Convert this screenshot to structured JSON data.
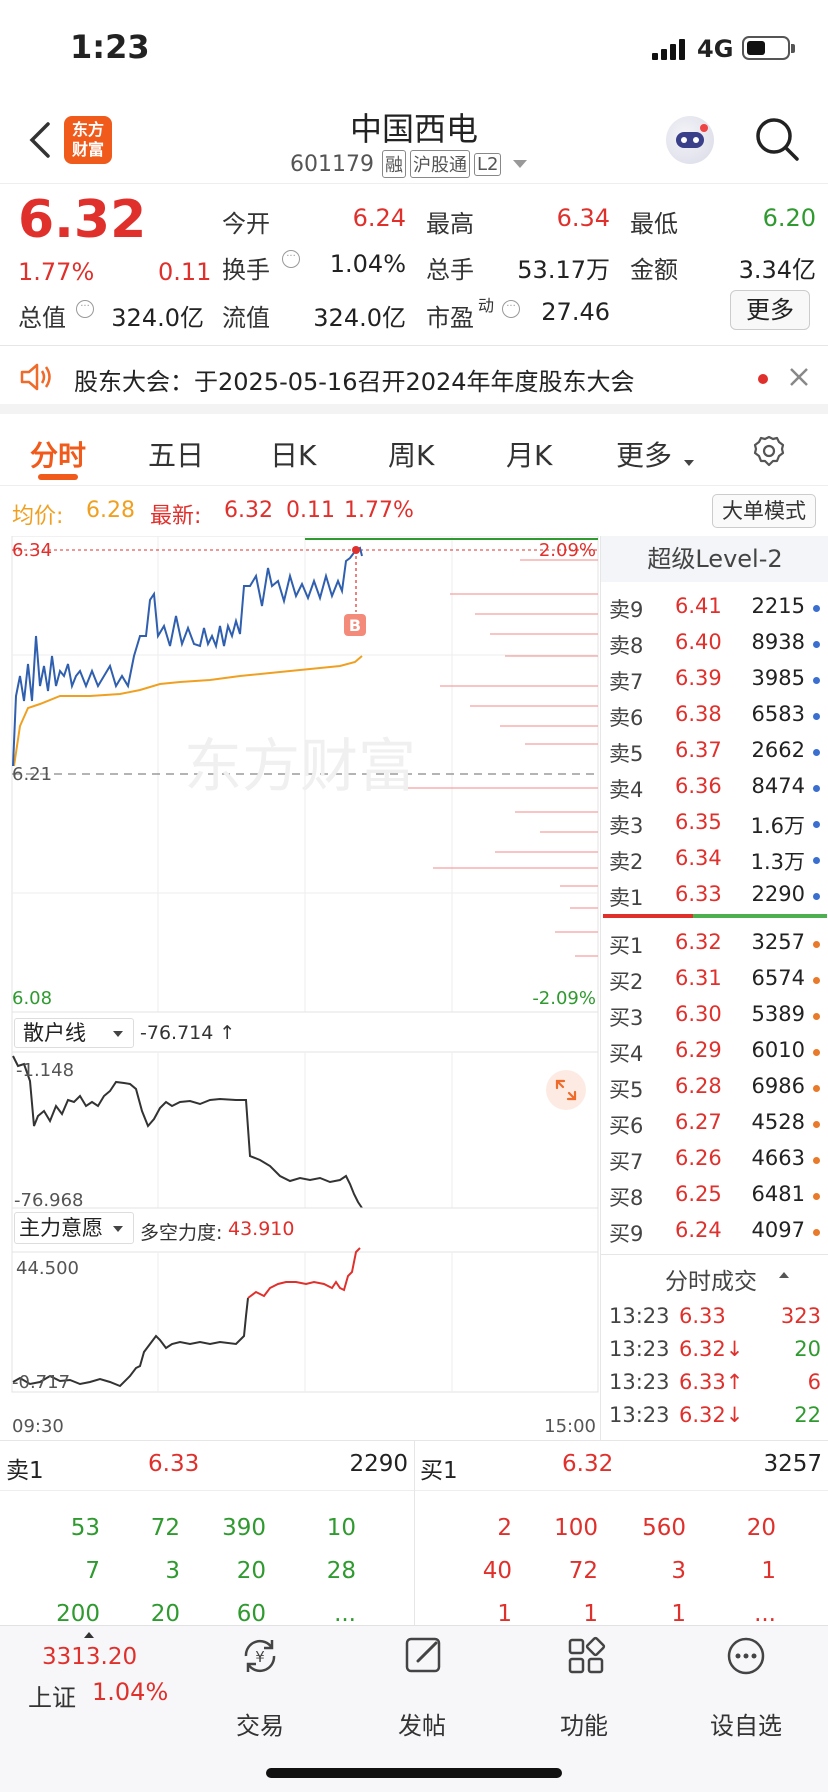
{
  "status_bar": {
    "time": "1:23",
    "network": "4G"
  },
  "header": {
    "logo_text_line1": "东方",
    "logo_text_line2": "财富",
    "stock_name": "中国西电",
    "stock_code": "601179",
    "badges": [
      "融",
      "沪股通",
      "L2"
    ]
  },
  "quote": {
    "price": "6.32",
    "change_pct": "1.77%",
    "change": "0.11",
    "total_value_label": "总值",
    "total_value": "324.0亿",
    "open_label": "今开",
    "open": "6.24",
    "high_label": "最高",
    "high": "6.34",
    "low_label": "最低",
    "low": "6.20",
    "turnover_label": "换手",
    "turnover": "1.04%",
    "volume_label": "总手",
    "volume": "53.17万",
    "amount_label": "金额",
    "amount": "3.34亿",
    "float_value_label": "流值",
    "float_value": "324.0亿",
    "pe_label": "市盈",
    "pe_sup": "动",
    "pe": "27.46",
    "more_button": "更多"
  },
  "notice": {
    "text": "股东大会：于2025-05-16召开2024年年度股东大会"
  },
  "tabs": [
    "分时",
    "五日",
    "日K",
    "周K",
    "月K",
    "更多"
  ],
  "info_line": {
    "avg_label": "均价:",
    "avg": "6.28",
    "latest_label": "最新:",
    "latest": "6.32",
    "chg": "0.11",
    "pct": "1.77%",
    "mode_button": "大单模式"
  },
  "chart": {
    "y_top": "6.34",
    "y_mid": "6.21",
    "y_bottom": "6.08",
    "pct_top": "2.09%",
    "pct_bottom": "-2.09%",
    "watermark": "东方财富",
    "marker": "B",
    "retail_select": "散户线",
    "retail_value": "-76.714 ↑",
    "retail_top": "-1.148",
    "retail_bottom": "-76.968",
    "main_select": "主力意愿",
    "main_force_label": "多空力度:",
    "main_force_value": "43.910",
    "main_top": "44.500",
    "main_bottom": "-0.717",
    "time_start": "09:30",
    "time_end": "15:00"
  },
  "level2": {
    "title": "超级Level-2",
    "sells": [
      {
        "label": "卖9",
        "price": "6.41",
        "vol": "2215"
      },
      {
        "label": "卖8",
        "price": "6.40",
        "vol": "8938"
      },
      {
        "label": "卖7",
        "price": "6.39",
        "vol": "3985"
      },
      {
        "label": "卖6",
        "price": "6.38",
        "vol": "6583"
      },
      {
        "label": "卖5",
        "price": "6.37",
        "vol": "2662"
      },
      {
        "label": "卖4",
        "price": "6.36",
        "vol": "8474"
      },
      {
        "label": "卖3",
        "price": "6.35",
        "vol": "1.6万"
      },
      {
        "label": "卖2",
        "price": "6.34",
        "vol": "1.3万"
      },
      {
        "label": "卖1",
        "price": "6.33",
        "vol": "2290"
      }
    ],
    "buys": [
      {
        "label": "买1",
        "price": "6.32",
        "vol": "3257"
      },
      {
        "label": "买2",
        "price": "6.31",
        "vol": "6574"
      },
      {
        "label": "买3",
        "price": "6.30",
        "vol": "5389"
      },
      {
        "label": "买4",
        "price": "6.29",
        "vol": "6010"
      },
      {
        "label": "买5",
        "price": "6.28",
        "vol": "6986"
      },
      {
        "label": "买6",
        "price": "6.27",
        "vol": "4528"
      },
      {
        "label": "买7",
        "price": "6.26",
        "vol": "4663"
      },
      {
        "label": "买8",
        "price": "6.25",
        "vol": "6481"
      },
      {
        "label": "买9",
        "price": "6.24",
        "vol": "4097"
      }
    ],
    "trades_title": "分时成交",
    "trades": [
      {
        "time": "13:23",
        "price": "6.33",
        "vol": "323"
      },
      {
        "time": "13:23",
        "price": "6.32↓",
        "vol": "20"
      },
      {
        "time": "13:23",
        "price": "6.33↑",
        "vol": "6"
      },
      {
        "time": "13:23",
        "price": "6.32↓",
        "vol": "22"
      }
    ]
  },
  "book": {
    "sell_label": "卖1",
    "sell_price": "6.33",
    "sell_vol": "2290",
    "buy_label": "买1",
    "buy_price": "6.32",
    "buy_vol": "3257",
    "sell_rows": [
      [
        "53",
        "72",
        "390",
        "10"
      ],
      [
        "7",
        "3",
        "20",
        "28"
      ],
      [
        "200",
        "20",
        "60",
        "..."
      ]
    ],
    "buy_rows": [
      [
        "2",
        "100",
        "560",
        "20"
      ],
      [
        "40",
        "72",
        "3",
        "1"
      ],
      [
        "1",
        "1",
        "1",
        "..."
      ]
    ]
  },
  "bottom_nav": {
    "index_value": "3313.20",
    "index_name": "上证",
    "index_pct": "1.04%",
    "items": [
      "交易",
      "发帖",
      "功能",
      "设自选"
    ]
  }
}
